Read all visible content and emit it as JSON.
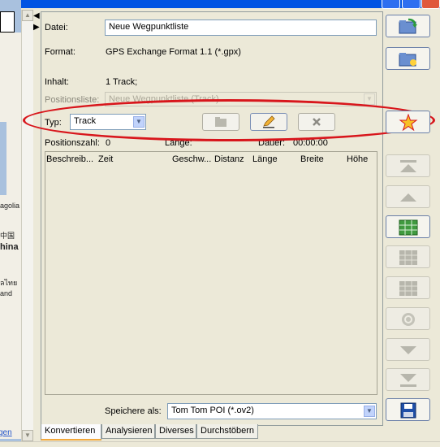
{
  "map": {
    "labels": [
      "agolia",
      "中国",
      "hina",
      "ลไทย",
      "and"
    ],
    "link": "gen"
  },
  "form": {
    "datei_label": "Datei:",
    "datei_value": "Neue Wegpunktliste",
    "format_label": "Format:",
    "format_value": "GPS Exchange Format 1.1 (*.gpx)",
    "inhalt_label": "Inhalt:",
    "inhalt_value": "1 Track;",
    "positionsliste_label": "Positionsliste:",
    "positionsliste_value": "Neue Wegpunktliste (Track)",
    "typ_label": "Typ:",
    "typ_value": "Track",
    "positionszahl_label": "Positionszahl:",
    "positionszahl_value": "0",
    "laenge_label": "Länge:",
    "dauer_label": "Dauer:",
    "dauer_value": "00:00:00",
    "speichere_label": "Speichere als:",
    "speichere_value": "Tom Tom POI (*.ov2)"
  },
  "table": {
    "columns": [
      "Beschreib...",
      "Zeit",
      "Geschw...",
      "Distanz",
      "Länge",
      "Breite",
      "Höhe"
    ]
  },
  "tabs": [
    "Konvertieren",
    "Analysieren",
    "Diverses",
    "Durchstöbern"
  ],
  "colors": {
    "highlight_oval": "#d8161c",
    "accent_tab": "#f3a83c"
  }
}
